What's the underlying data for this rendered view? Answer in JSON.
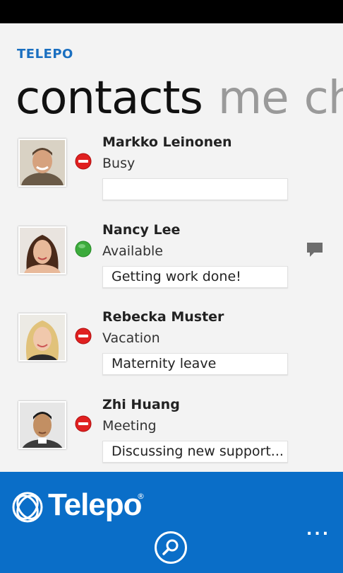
{
  "app": {
    "brand": "TELEPO",
    "logo_text": "Telepo",
    "reg_mark": "®"
  },
  "pivot": {
    "items": [
      "contacts",
      "me",
      "ch"
    ],
    "active_index": 0
  },
  "contacts": [
    {
      "name": "Markko Leinonen",
      "status": "Busy",
      "note": "",
      "presence": "busy",
      "presence_color": "#e02020",
      "avatar_icon": "person-photo"
    },
    {
      "name": "Nancy Lee",
      "status": "Available",
      "note": "Getting work done!",
      "presence": "available",
      "presence_color": "#3cab3c",
      "avatar_icon": "person-photo",
      "has_chat": true
    },
    {
      "name": "Rebecka Muster",
      "status": "Vacation",
      "note": "Maternity leave",
      "presence": "busy",
      "presence_color": "#e02020",
      "avatar_icon": "person-photo"
    },
    {
      "name": "Zhi Huang",
      "status": "Meeting",
      "note": "Discussing new support...",
      "presence": "busy",
      "presence_color": "#e02020",
      "avatar_icon": "person-photo"
    }
  ],
  "appbar": {
    "search_icon": "search-icon",
    "more_label": "..."
  },
  "colors": {
    "accent": "#0a6ec8",
    "brand": "#1a6fc0",
    "background": "#f3f3f3"
  }
}
